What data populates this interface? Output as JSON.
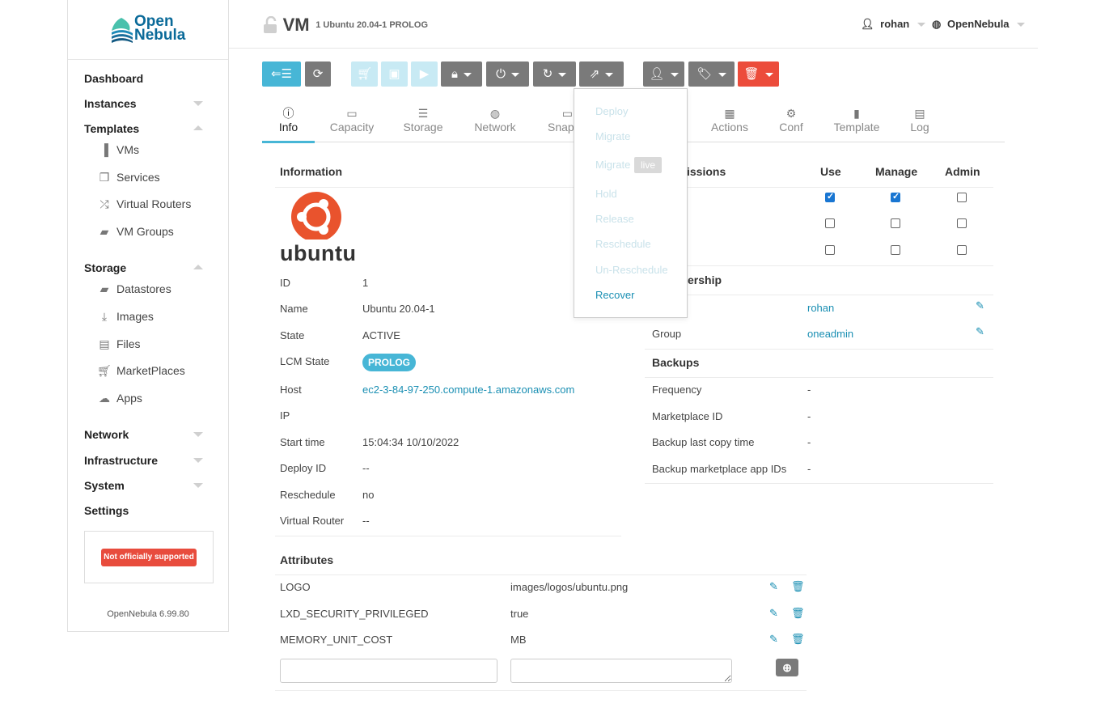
{
  "brand": {
    "line1": "Open",
    "line2": "Nebula"
  },
  "sidebar": {
    "main": [
      {
        "label": "Dashboard"
      },
      {
        "label": "Instances"
      },
      {
        "label": "Templates"
      },
      {
        "label": "Storage"
      },
      {
        "label": "Network"
      },
      {
        "label": "Infrastructure"
      },
      {
        "label": "System"
      },
      {
        "label": "Settings"
      }
    ],
    "templates_sub": [
      {
        "label": "VMs",
        "icon": "file-icon"
      },
      {
        "label": "Services",
        "icon": "files-icon"
      },
      {
        "label": "Virtual Routers",
        "icon": "shuffle-icon"
      },
      {
        "label": "VM Groups",
        "icon": "folder-open-icon"
      }
    ],
    "storage_sub": [
      {
        "label": "Datastores",
        "icon": "folder-open-icon"
      },
      {
        "label": "Images",
        "icon": "download-icon"
      },
      {
        "label": "Files",
        "icon": "archive-icon"
      },
      {
        "label": "MarketPlaces",
        "icon": "cart-icon"
      },
      {
        "label": "Apps",
        "icon": "cloud-download-icon"
      }
    ],
    "unsupported": "Not officially supported",
    "version": "OpenNebula 6.99.80"
  },
  "header": {
    "title": "VM",
    "subtitle": "1 Ubuntu 20.04-1 PROLOG",
    "user": "rohan",
    "zone": "OpenNebula"
  },
  "tabs": [
    {
      "label": "Info",
      "icon": "info-icon"
    },
    {
      "label": "Capacity",
      "icon": "laptop-icon"
    },
    {
      "label": "Storage",
      "icon": "server-icon"
    },
    {
      "label": "Network",
      "icon": "globe-icon"
    },
    {
      "label": "Snaps",
      "icon": "laptop-icon"
    },
    {
      "label": "Actions",
      "icon": "calendar-icon"
    },
    {
      "label": "Conf",
      "icon": "cog-icon"
    },
    {
      "label": "Template",
      "icon": "file-icon"
    },
    {
      "label": "Log",
      "icon": "file-text-icon"
    }
  ],
  "information": {
    "title": "Information",
    "logo_text": "ubuntu",
    "rows": [
      {
        "label": "ID",
        "value": "1"
      },
      {
        "label": "Name",
        "value": "Ubuntu 20.04-1"
      },
      {
        "label": "State",
        "value": "ACTIVE"
      },
      {
        "label": "LCM State",
        "value": "PROLOG"
      },
      {
        "label": "Host",
        "value": "ec2-3-84-97-250.compute-1.amazonaws.com"
      },
      {
        "label": "IP",
        "value": ""
      },
      {
        "label": "Start time",
        "value": "15:04:34 10/10/2022"
      },
      {
        "label": "Deploy ID",
        "value": "--"
      },
      {
        "label": "Reschedule",
        "value": "no"
      },
      {
        "label": "Virtual Router",
        "value": "--"
      }
    ]
  },
  "permissions": {
    "title_partial": "issions",
    "headers": [
      "Use",
      "Manage",
      "Admin"
    ],
    "rows": [
      {
        "use": true,
        "manage": true,
        "admin": false
      },
      {
        "use": false,
        "manage": false,
        "admin": false
      },
      {
        "use": false,
        "manage": false,
        "admin": false
      }
    ]
  },
  "ownership": {
    "title_partial": "ership",
    "group_label": "Group",
    "owner": "rohan",
    "group": "oneadmin"
  },
  "backups": {
    "title": "Backups",
    "rows": [
      {
        "label": "Frequency",
        "value": "-"
      },
      {
        "label": "Marketplace ID",
        "value": "-"
      },
      {
        "label": "Backup last copy time",
        "value": "-"
      },
      {
        "label": "Backup marketplace app IDs",
        "value": "-"
      }
    ]
  },
  "attributes": {
    "title": "Attributes",
    "rows": [
      {
        "key": "LOGO",
        "value": "images/logos/ubuntu.png"
      },
      {
        "key": "LXD_SECURITY_PRIVILEGED",
        "value": "true"
      },
      {
        "key": "MEMORY_UNIT_COST",
        "value": "MB"
      }
    ],
    "new_key": "",
    "new_value": ""
  },
  "dropdown": {
    "items": [
      {
        "label": "Deploy",
        "enabled": false
      },
      {
        "label": "Migrate",
        "enabled": false
      },
      {
        "label": "Migrate",
        "enabled": false
      },
      {
        "label": "Hold",
        "enabled": false
      },
      {
        "label": "Release",
        "enabled": false
      },
      {
        "label": "Reschedule",
        "enabled": false
      },
      {
        "label": "Un-Reschedule",
        "enabled": false
      },
      {
        "label": "Recover",
        "enabled": true
      }
    ],
    "live_badge": "live"
  },
  "colors": {
    "accent": "#47b6d6",
    "link": "#1a8fb3",
    "danger": "#ec4c3b",
    "ubuntu": "#e9532d"
  }
}
